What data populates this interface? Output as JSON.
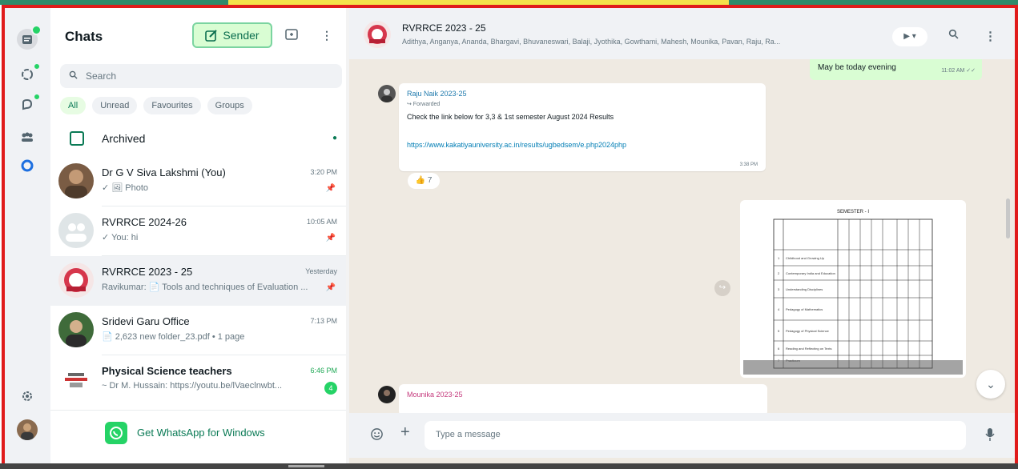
{
  "sidebar": {
    "title": "Chats",
    "sender_label": "Sender",
    "search_placeholder": "Search",
    "filters": [
      "All",
      "Unread",
      "Favourites",
      "Groups"
    ],
    "archived_label": "Archived",
    "chats": [
      {
        "name": "Dr G V Siva Lakshmi (You)",
        "preview": "✓ 🖼 Photo",
        "time": "3:20 PM"
      },
      {
        "name": "RVRRCE 2024-26",
        "preview": "✓ You: hi",
        "time": "10:05 AM"
      },
      {
        "name": "RVRRCE 2023 - 25",
        "preview": "Ravikumar: 📄 Tools and techniques of Evaluation ...",
        "time": "Yesterday"
      },
      {
        "name": "Sridevi Garu Office",
        "preview": "📄 2,623 new folder_23.pdf • 1 page",
        "time": "7:13 PM"
      },
      {
        "name": "Physical Science teachers",
        "preview": "~ Dr M. Hussain: https://youtu.be/lVaeclnwbt...",
        "time": "6:46 PM",
        "unread": "4"
      }
    ],
    "get_windows": "Get WhatsApp for Windows"
  },
  "conversation": {
    "title": "RVRRCE 2023 - 25",
    "members": "Adithya, Anganya, Ananda, Bhargavi, Bhuvaneswari, Balaji, Jyothika, Gowthami, Mahesh, Mounika, Pavan, Raju, Ra...",
    "video_label": "▶ ▾",
    "out_msg": {
      "text": "May be today evening",
      "time": "11:02 AM ✓✓"
    },
    "msg1": {
      "sender": "Raju Naik 2023-25",
      "forwarded": "↪ Forwarded",
      "text": "Check the link below for 3,3 & 1st semester August 2024 Results",
      "link": "https://www.kakatiyauniversity.ac.in/results/ugbedsem/e.php2024php",
      "time": "3:38 PM"
    },
    "reaction": "👍 7",
    "msg2_sender": "Mounika 2023-25",
    "composer_placeholder": "Type a message",
    "doc": {
      "heading": "SEMESTER - I",
      "rows": [
        [
          "1",
          "Childhood and Growing Up"
        ],
        [
          "2",
          "Contemporary India and Education"
        ],
        [
          "3",
          "Understanding Disciplines"
        ],
        [
          "4",
          "Pedagogy of Mathematics"
        ],
        [
          "5",
          "Pedagogy of Physical Science"
        ],
        [
          "6",
          "Reading and Reflecting on Texts"
        ],
        [
          "7",
          "Practicum"
        ]
      ]
    }
  },
  "colors": {
    "accent": "#25d366",
    "frame": "#e01b1b",
    "chat_bg": "#efeae2",
    "out_bubble": "#d9fdd3"
  }
}
